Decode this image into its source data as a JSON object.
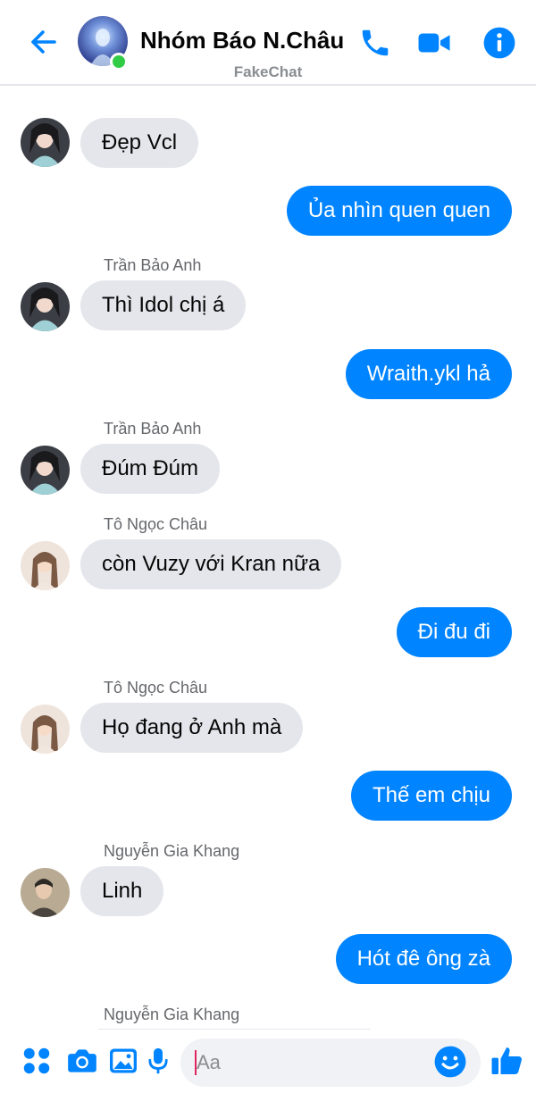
{
  "header": {
    "title": "Nhóm Báo N.Châu",
    "subtitle": "FakeChat",
    "back_icon": "back-arrow-icon",
    "call_icon": "phone-icon",
    "video_icon": "video-camera-icon",
    "info_icon": "info-icon",
    "accent_color": "#0084ff",
    "online_color": "#31cc46"
  },
  "messages": [
    {
      "side": "in",
      "sender": "",
      "text": "Đẹp Vcl"
    },
    {
      "side": "out",
      "text": "Ủa nhìn quen quen"
    },
    {
      "side": "in",
      "sender": "Trần Bảo Anh",
      "text": "Thì Idol chị á"
    },
    {
      "side": "out",
      "text": "Wraith.ykl hả"
    },
    {
      "side": "in",
      "sender": "Trần Bảo Anh",
      "text": "Đúm Đúm"
    },
    {
      "side": "in",
      "sender": "Tô Ngọc Châu",
      "text": "còn Vuzy với Kran nữa"
    },
    {
      "side": "out",
      "text": "Đi đu đi"
    },
    {
      "side": "in",
      "sender": "Tô Ngọc Châu",
      "text": "Họ đang ở Anh mà"
    },
    {
      "side": "out",
      "text": "Thế em chịu"
    },
    {
      "side": "in",
      "sender": "Nguyễn Gia Khang",
      "text": "Linh"
    },
    {
      "side": "out",
      "text": "Hót đê ông zà"
    },
    {
      "side": "in",
      "sender": "Nguyễn Gia Khang",
      "text": ""
    }
  ],
  "composer": {
    "placeholder": "Aa",
    "value": "",
    "apps_icon": "apps-grid-icon",
    "camera_icon": "camera-icon",
    "gallery_icon": "image-icon",
    "mic_icon": "microphone-icon",
    "emoji_icon": "emoji-icon",
    "like_icon": "thumbs-up-icon"
  },
  "colors": {
    "outgoing_bubble": "#0084ff",
    "incoming_bubble": "#e4e6eb"
  }
}
